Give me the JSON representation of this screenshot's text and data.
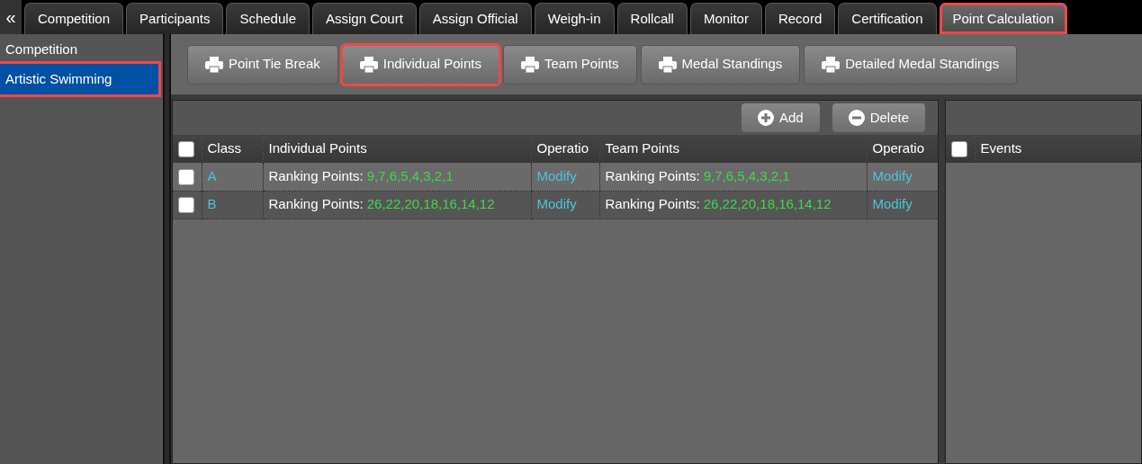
{
  "collapse_glyph": "«",
  "tabs": [
    {
      "label": "Competition",
      "selected": false,
      "highlighted": false
    },
    {
      "label": "Participants",
      "selected": false,
      "highlighted": false
    },
    {
      "label": "Schedule",
      "selected": false,
      "highlighted": false
    },
    {
      "label": "Assign Court",
      "selected": false,
      "highlighted": false
    },
    {
      "label": "Assign Official",
      "selected": false,
      "highlighted": false
    },
    {
      "label": "Weigh-in",
      "selected": false,
      "highlighted": false
    },
    {
      "label": "Rollcall",
      "selected": false,
      "highlighted": false
    },
    {
      "label": "Monitor",
      "selected": false,
      "highlighted": false
    },
    {
      "label": "Record",
      "selected": false,
      "highlighted": false
    },
    {
      "label": "Certification",
      "selected": false,
      "highlighted": false
    },
    {
      "label": "Point Calculation",
      "selected": true,
      "highlighted": true
    }
  ],
  "sidebar": {
    "title": "Competition",
    "items": [
      {
        "label": "Artistic Swimming",
        "selected": true,
        "highlighted": true
      }
    ]
  },
  "toolbar": {
    "buttons": [
      {
        "label": "Point Tie Break",
        "highlighted": false
      },
      {
        "label": "Individual Points",
        "highlighted": true
      },
      {
        "label": "Team Points",
        "highlighted": false
      },
      {
        "label": "Medal Standings",
        "highlighted": false
      },
      {
        "label": "Detailed Medal Standings",
        "highlighted": false
      }
    ]
  },
  "grid": {
    "actions": [
      {
        "kind": "add",
        "label": "Add"
      },
      {
        "kind": "delete",
        "label": "Delete"
      }
    ],
    "header_checked": false,
    "columns": [
      "Class",
      "Individual Points",
      "Operatio",
      "Team Points",
      "Operatio"
    ],
    "rows": [
      {
        "checked": false,
        "class": "A",
        "individual": {
          "label": "Ranking Points:",
          "values": "9,7,6,5,4,3,2,1"
        },
        "individual_action": "Modify",
        "team": {
          "label": "Ranking Points:",
          "values": "9,7,6,5,4,3,2,1"
        },
        "team_action": "Modify"
      },
      {
        "checked": false,
        "class": "B",
        "individual": {
          "label": "Ranking Points:",
          "values": "26,22,20,18,16,14,12"
        },
        "individual_action": "Modify",
        "team": {
          "label": "Ranking Points:",
          "values": "26,22,20,18,16,14,12"
        },
        "team_action": "Modify"
      }
    ]
  },
  "events_grid": {
    "header_checked": false,
    "columns": [
      "Events"
    ]
  }
}
